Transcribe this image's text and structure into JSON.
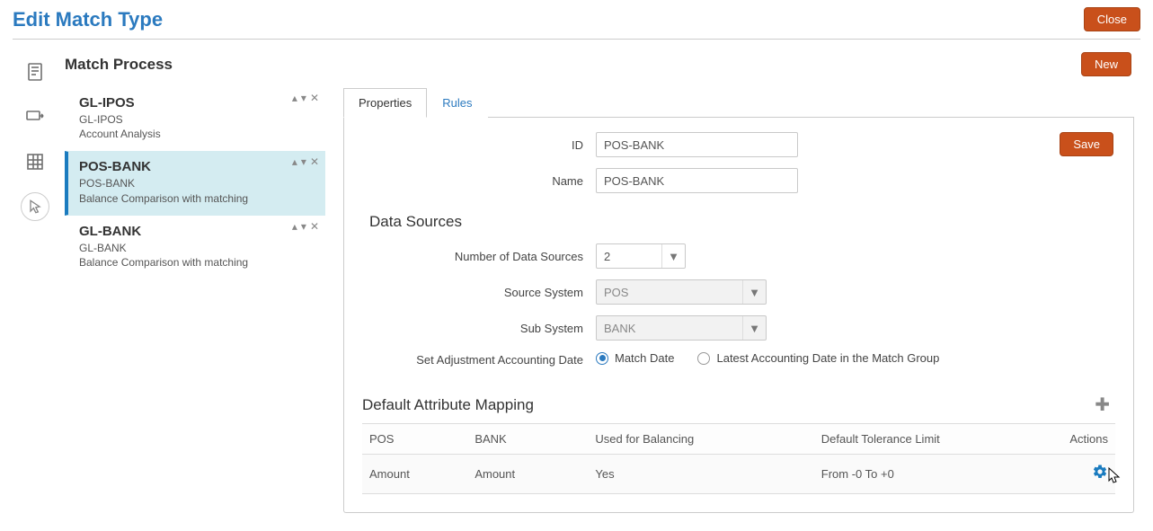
{
  "header": {
    "title": "Edit Match Type",
    "close": "Close"
  },
  "section": {
    "title": "Match Process",
    "new_btn": "New"
  },
  "sidebar": {
    "items": [
      {
        "title": "GL-IPOS",
        "sub1": "GL-IPOS",
        "sub2": "Account Analysis",
        "selected": false
      },
      {
        "title": "POS-BANK",
        "sub1": "POS-BANK",
        "sub2": "Balance Comparison with matching",
        "selected": true
      },
      {
        "title": "GL-BANK",
        "sub1": "GL-BANK",
        "sub2": "Balance Comparison with matching",
        "selected": false
      }
    ]
  },
  "tabs": {
    "properties": "Properties",
    "rules": "Rules"
  },
  "form": {
    "id_label": "ID",
    "id_value": "POS-BANK",
    "name_label": "Name",
    "name_value": "POS-BANK",
    "save": "Save"
  },
  "data_sources": {
    "header": "Data Sources",
    "num_label": "Number of Data Sources",
    "num_value": "2",
    "source_label": "Source System",
    "source_value": "POS",
    "sub_label": "Sub System",
    "sub_value": "BANK",
    "adj_label": "Set Adjustment Accounting Date",
    "radio1": "Match Date",
    "radio2": "Latest Accounting Date in the Match Group"
  },
  "mapping": {
    "header": "Default Attribute Mapping",
    "columns": {
      "c0": "POS",
      "c1": "BANK",
      "c2": "Used for Balancing",
      "c3": "Default Tolerance Limit",
      "c4": "Actions"
    },
    "row": {
      "pos": "Amount",
      "bank": "Amount",
      "balancing": "Yes",
      "tolerance": "From -0 To +0"
    }
  }
}
